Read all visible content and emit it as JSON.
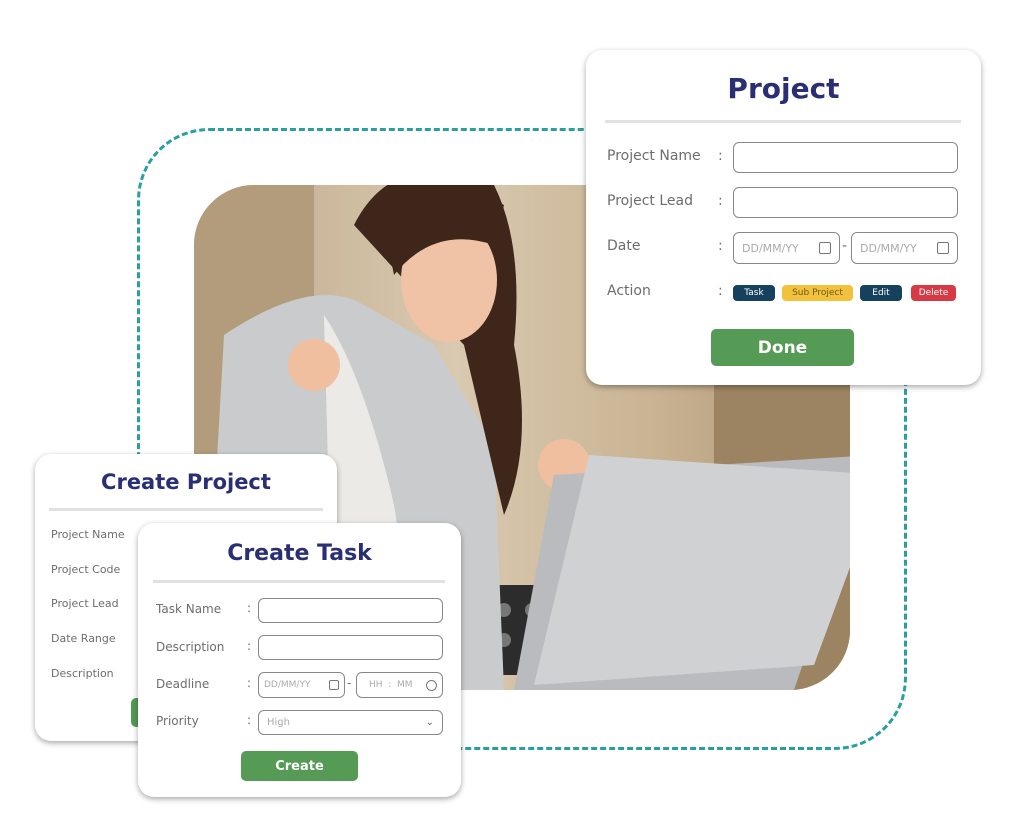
{
  "project_card": {
    "title": "Project",
    "fields": [
      {
        "label": "Project Name",
        "value": ""
      },
      {
        "label": "Project Lead",
        "value": ""
      }
    ],
    "date": {
      "label": "Date",
      "start_placeholder": "DD/MM/YY",
      "end_placeholder": "DD/MM/YY",
      "separator": "-"
    },
    "action": {
      "label": "Action",
      "buttons": [
        {
          "label": "Task",
          "color": "#15415e"
        },
        {
          "label": "Sub Project",
          "color": "#f2c23c"
        },
        {
          "label": "Edit",
          "color": "#15415e"
        },
        {
          "label": "Delete",
          "color": "#d83a45"
        }
      ]
    },
    "done_label": "Done",
    "colon": ":"
  },
  "create_project_card": {
    "title": "Create Project",
    "labels": [
      "Project Name",
      "Project Code",
      "Project Lead",
      "Date Range",
      "Description"
    ]
  },
  "create_task_card": {
    "title": "Create Task",
    "fields": [
      {
        "label": "Task Name",
        "value": ""
      },
      {
        "label": "Description",
        "value": ""
      }
    ],
    "deadline": {
      "label": "Deadline",
      "date_placeholder": "DD/MM/YY",
      "time_placeholder": "HH  :  MM",
      "separator": "-"
    },
    "priority": {
      "label": "Priority",
      "value": "High"
    },
    "create_label": "Create",
    "colon": ":"
  },
  "colors": {
    "accent_teal": "#2a9fa0",
    "title_navy": "#2a2f74",
    "button_green": "#559a55"
  }
}
